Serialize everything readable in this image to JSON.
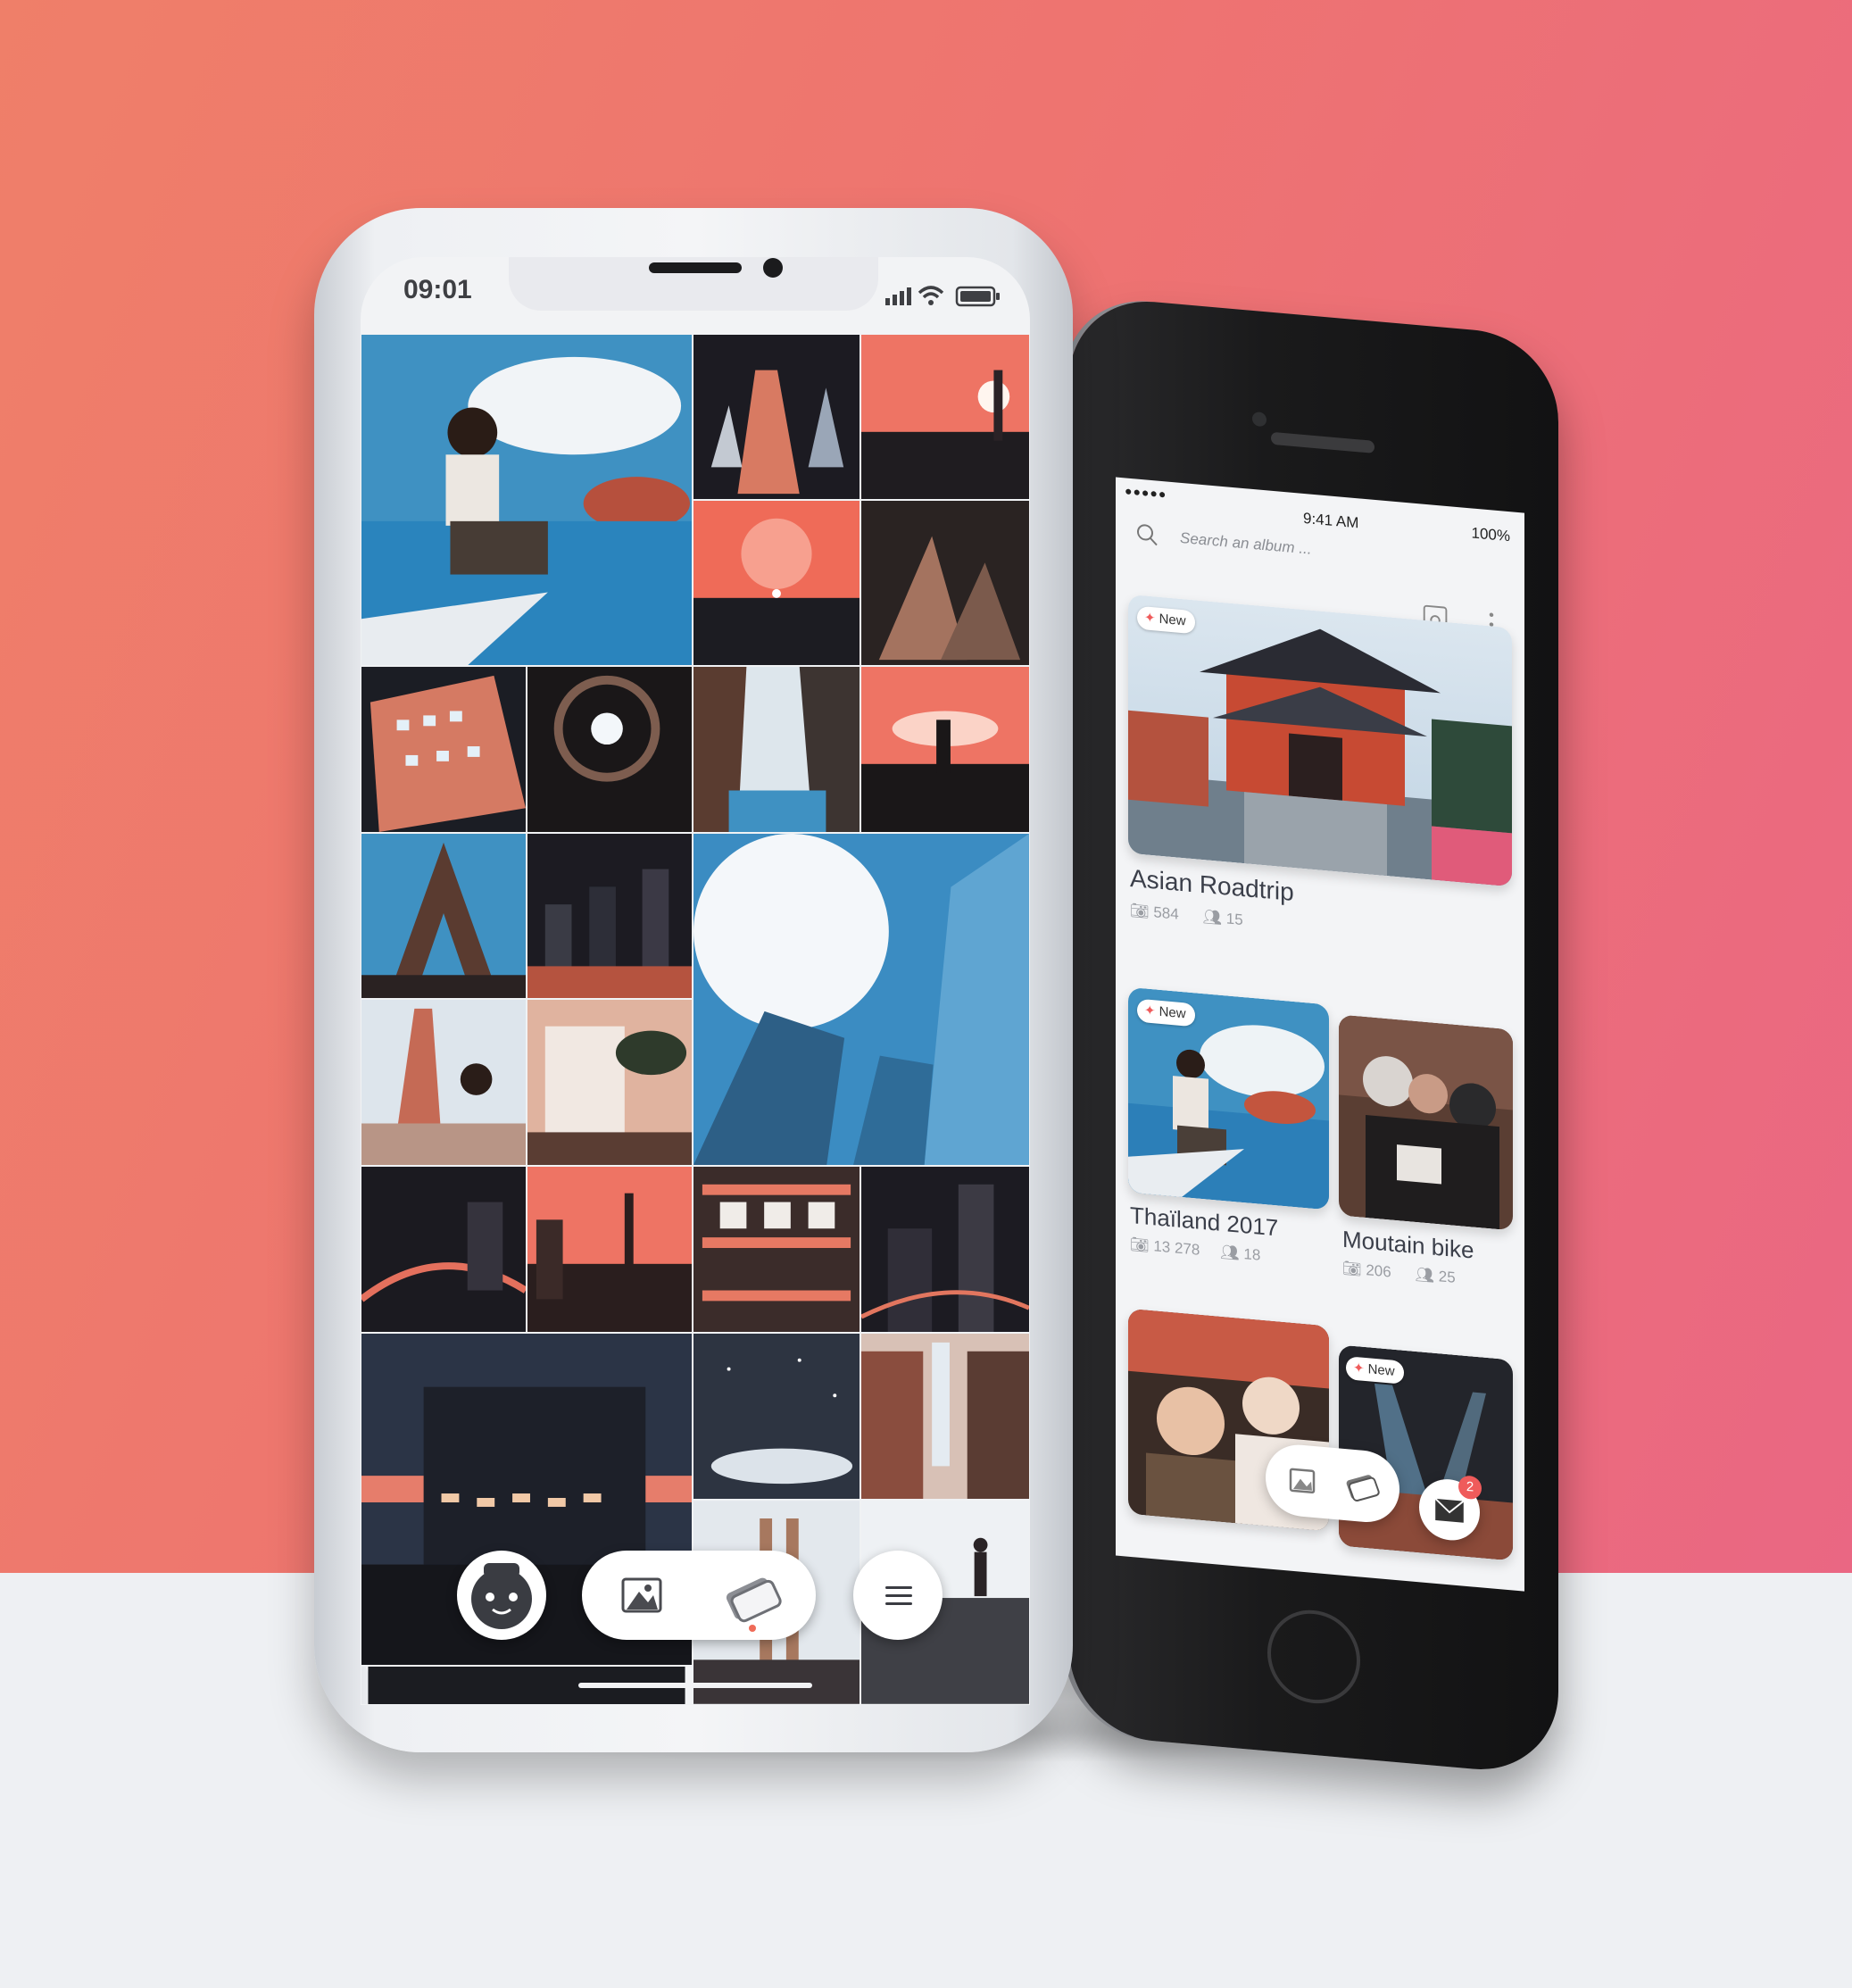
{
  "colors": {
    "accent": "#ef6b58",
    "photo_blue": "#3f91c2",
    "photo_salmon": "#ee7464",
    "photo_dark": "#1b1d24"
  },
  "left_phone": {
    "status_bar": {
      "time": "09:01",
      "icons": [
        "signal-icon",
        "wifi-icon",
        "battery-icon"
      ]
    },
    "photo_grid_icon_labels": [
      "photo",
      "album",
      "mascot",
      "menu"
    ],
    "dock": {
      "avatar_icon": "mascot-avatar-icon",
      "photos_icon": "photos-icon",
      "albums_icon": "albums-icon",
      "menu_icon": "menu-icon",
      "active_tab": "albums"
    }
  },
  "right_phone": {
    "status_bar": {
      "signal": "●●●●●",
      "time": "9:41 AM",
      "battery": "100%"
    },
    "search": {
      "placeholder": "Search an album ..."
    },
    "albums": [
      {
        "title": "Asian Roadtrip",
        "photos": "584",
        "members": "15",
        "is_new": true,
        "badge": "New"
      },
      {
        "title": "Thaïland 2017",
        "photos": "13 278",
        "members": "18",
        "is_new": true,
        "badge": "New"
      },
      {
        "title": "Moutain bike",
        "photos": "206",
        "members": "25",
        "is_new": false
      },
      {
        "title": "",
        "is_new": false
      },
      {
        "title": "",
        "is_new": true,
        "badge": "New"
      }
    ],
    "fab": {
      "photos_icon": "photos-icon",
      "albums_icon": "albums-icon",
      "mail_icon": "mail-icon",
      "unread_count": "2"
    }
  }
}
